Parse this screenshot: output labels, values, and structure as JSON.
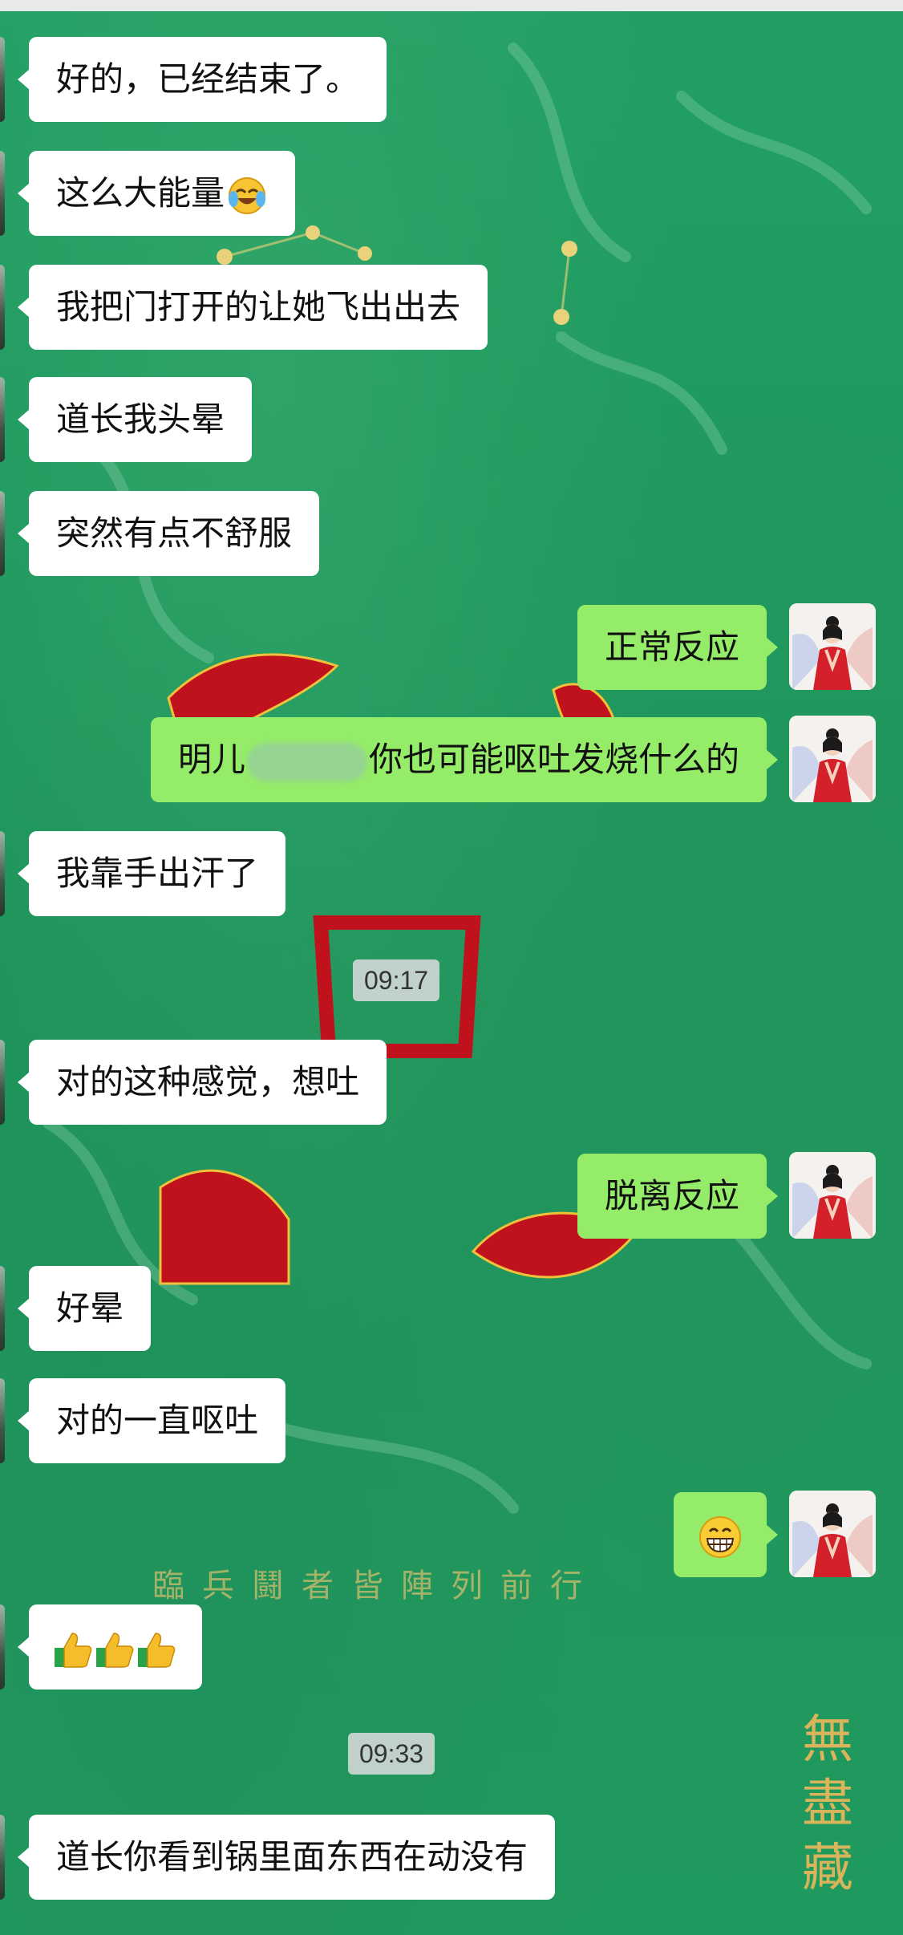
{
  "messages": [
    {
      "side": "in",
      "text": "好的，已经结束了。"
    },
    {
      "side": "in",
      "text": "这么大能量",
      "emoji": "crying-laughing-emoji"
    },
    {
      "side": "in",
      "text": "我把门打开的让她飞出出去"
    },
    {
      "side": "in",
      "text": "道长我头晕"
    },
    {
      "side": "in",
      "text": "突然有点不舒服"
    },
    {
      "side": "out",
      "text": "正常反应"
    },
    {
      "side": "out",
      "text_before": "明儿",
      "text_after": "你也可能呕吐发烧什么的",
      "redacted": true
    },
    {
      "side": "in",
      "text": "我靠手出汗了"
    },
    {
      "type": "time",
      "text": "09:17"
    },
    {
      "side": "in",
      "text": "对的这种感觉，想吐"
    },
    {
      "side": "out",
      "text": "脱离反应"
    },
    {
      "side": "in",
      "text": "好晕"
    },
    {
      "side": "in",
      "text": "对的一直呕吐"
    },
    {
      "side": "out",
      "emoji": "grinning-face-emoji"
    },
    {
      "side": "in",
      "emoji": "thumbs-up-emoji-x3"
    },
    {
      "type": "time",
      "text": "09:33"
    },
    {
      "side": "in",
      "text": "道长你看到锅里面东西在动没有"
    }
  ],
  "background": {
    "caption": "臨兵鬪者皆陣列前行",
    "seal": "無盡藏"
  },
  "colors": {
    "chat_background": "#1f9a5e",
    "incoming_bubble": "#ffffff",
    "outgoing_bubble": "#95ec69",
    "time_badge": "#dcdcdc"
  }
}
